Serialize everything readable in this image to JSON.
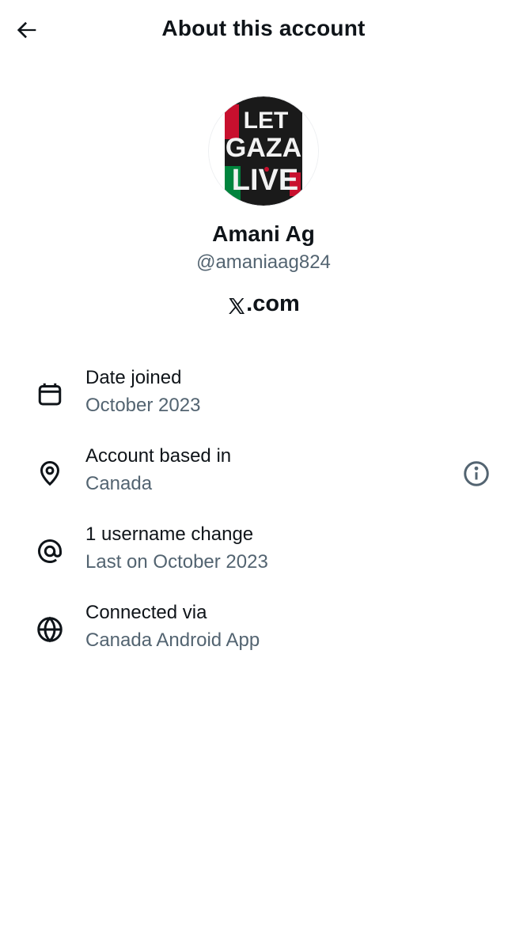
{
  "header": {
    "title": "About this account",
    "back_icon": "arrow-left-icon"
  },
  "profile": {
    "display_name": "Amani Ag",
    "handle": "@amaniaag824",
    "avatar_text": [
      "LET",
      "GAZA",
      "LIVE"
    ],
    "avatar_colors": [
      "#1a1a1a",
      "#c8102e",
      "#00843d",
      "#f2f2f2"
    ]
  },
  "brand": {
    "x_glyph": "𝕏",
    "domain": ".com"
  },
  "details": [
    {
      "icon": "calendar-icon",
      "label": "Date joined",
      "value": "October 2023"
    },
    {
      "icon": "location-pin-icon",
      "label": "Account based in",
      "value": "Canada",
      "info_icon": "info-icon"
    },
    {
      "icon": "at-sign-icon",
      "label": "1 username change",
      "value": "Last on October 2023"
    },
    {
      "icon": "globe-icon",
      "label": "Connected via",
      "value": "Canada Android App"
    }
  ],
  "colors": {
    "text_primary": "#0f1419",
    "text_secondary": "#536471"
  }
}
